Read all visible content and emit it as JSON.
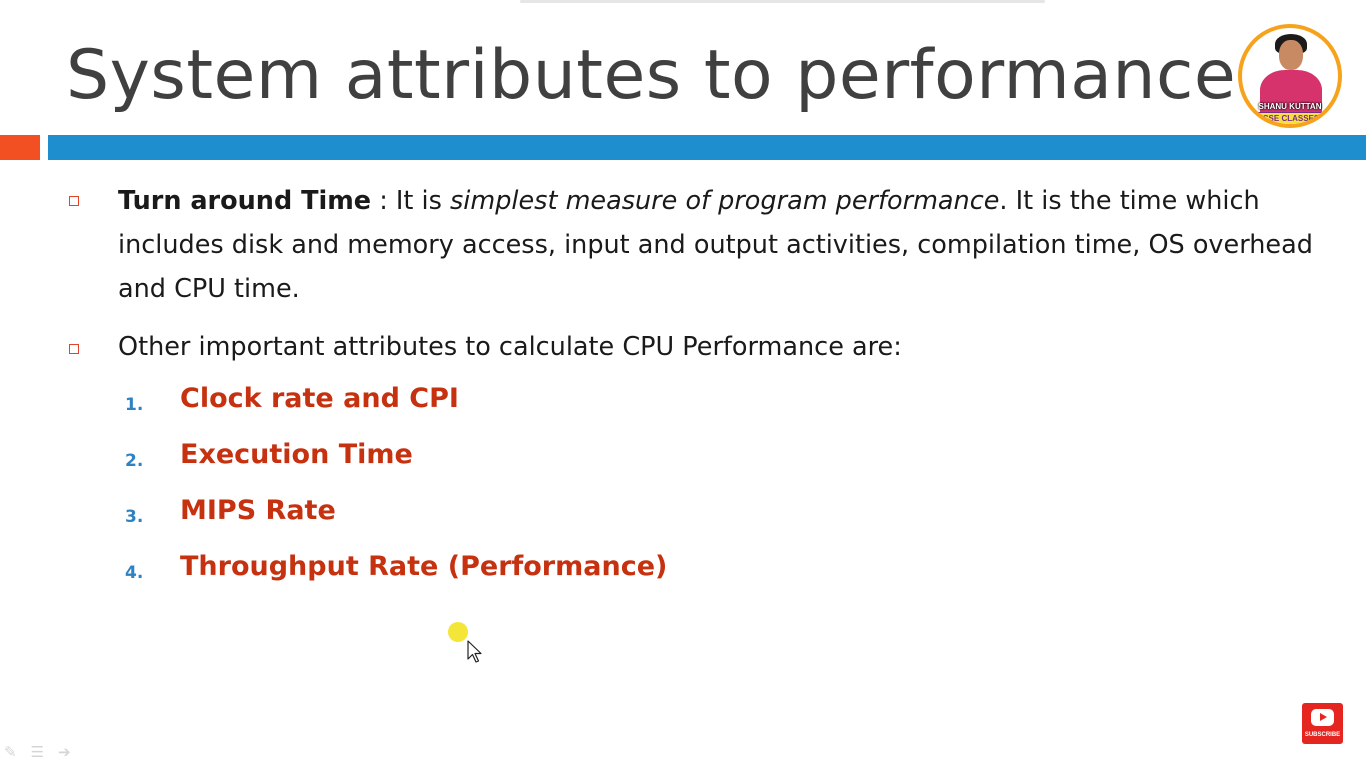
{
  "slide": {
    "title": "System attributes to performance",
    "logo": {
      "name_text": "SHANU KUTTAN",
      "tag_text": "CSE CLASSES"
    },
    "bullets": [
      {
        "term": "Turn around Time",
        "sep": " : It is ",
        "italic": "simplest measure of program performance",
        "rest": ". It is the time which includes disk and memory access, input and output activities, compilation time, OS overhead and CPU time."
      },
      {
        "text": "Other important attributes to calculate CPU Performance are:"
      }
    ],
    "attributes": [
      {
        "num": "1.",
        "label": "Clock rate and CPI"
      },
      {
        "num": "2.",
        "label": "Execution Time"
      },
      {
        "num": "3.",
        "label": "MIPS Rate"
      },
      {
        "num": "4.",
        "label": "Throughput Rate (Performance)"
      }
    ]
  },
  "subscribe": {
    "label": "SUBSCRIBE"
  },
  "colors": {
    "accent_blue": "#1e8ecf",
    "accent_orange": "#f25022",
    "item_red": "#c63110",
    "number_blue": "#2f82c2"
  },
  "icons": {
    "bullet": "square-bullet-icon",
    "cursor": "mouse-pointer-icon",
    "subscribe": "youtube-play-icon"
  }
}
